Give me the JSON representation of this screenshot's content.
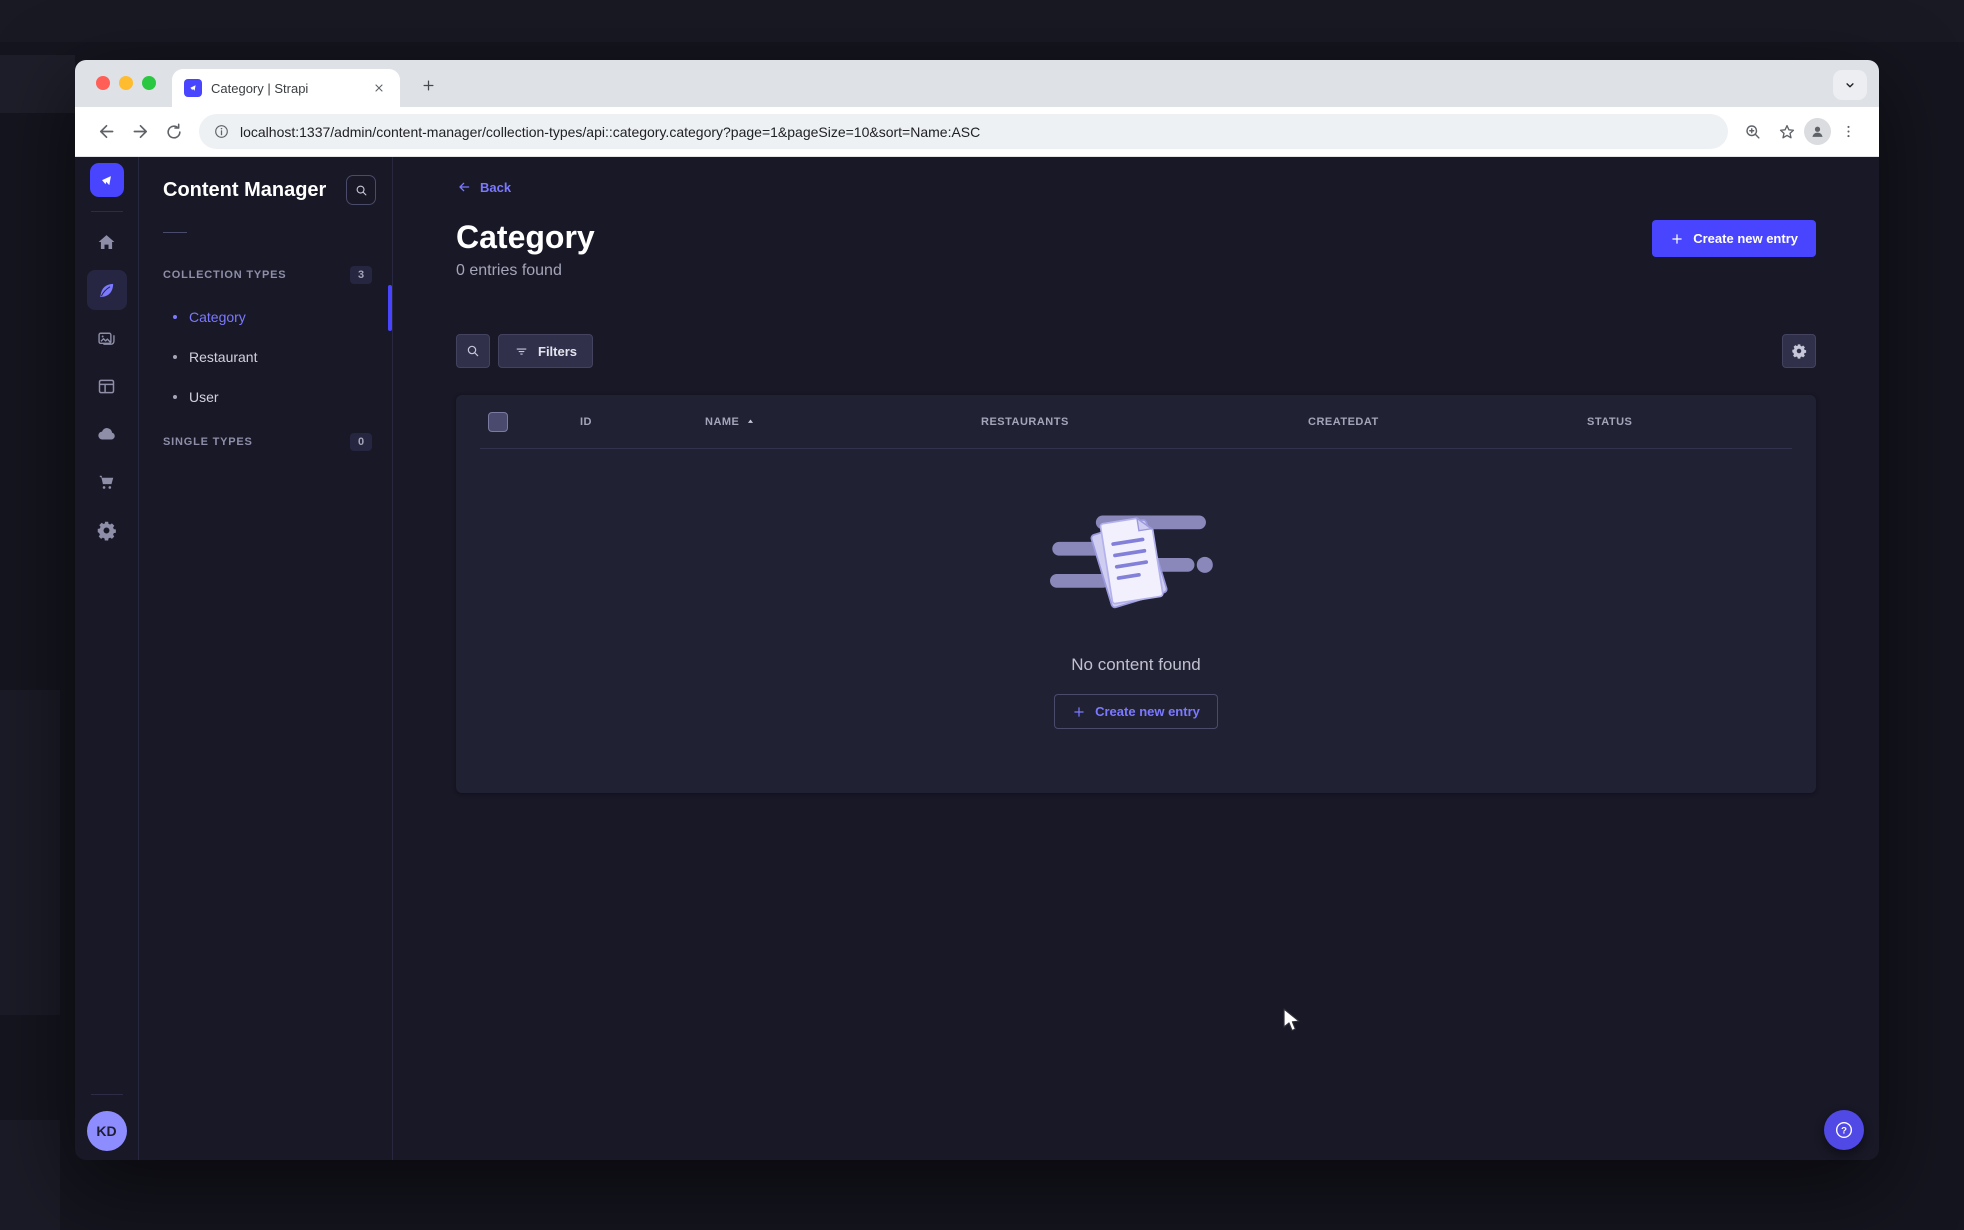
{
  "colors": {
    "accent": "#4945ff",
    "accent_light": "#7b79ff",
    "page_bg": "#181826",
    "card_bg": "#212134"
  },
  "browser": {
    "tab_title": "Category | Strapi",
    "url": "localhost:1337/admin/content-manager/collection-types/api::category.category?page=1&pageSize=10&sort=Name:ASC"
  },
  "nav": {
    "avatar_initials": "KD"
  },
  "subnav": {
    "title": "Content Manager",
    "collection_types": {
      "label": "COLLECTION TYPES",
      "count": "3"
    },
    "items": [
      {
        "label": "Category"
      },
      {
        "label": "Restaurant"
      },
      {
        "label": "User"
      }
    ],
    "single_types": {
      "label": "SINGLE TYPES",
      "count": "0"
    }
  },
  "main": {
    "back_label": "Back",
    "title": "Category",
    "subtitle": "0 entries found",
    "create_button": "Create new entry",
    "filters_button": "Filters",
    "table": {
      "columns": [
        "ID",
        "NAME",
        "RESTAURANTS",
        "CREATEDAT",
        "STATUS"
      ],
      "sorted_column": "NAME",
      "sort_direction": "ASC",
      "empty": {
        "message": "No content found",
        "create_button": "Create new entry"
      }
    }
  }
}
